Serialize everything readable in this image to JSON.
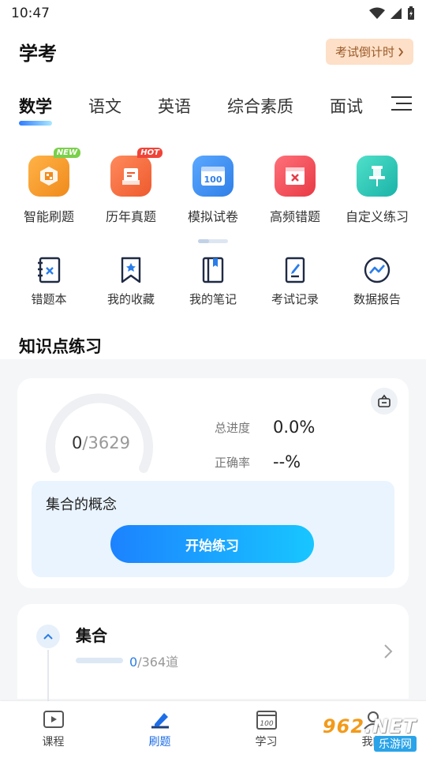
{
  "status": {
    "time": "10:47"
  },
  "header": {
    "title": "学考",
    "countdown_label": "考试倒计时"
  },
  "tabs": [
    {
      "label": "数学",
      "active": true
    },
    {
      "label": "语文"
    },
    {
      "label": "英语"
    },
    {
      "label": "综合素质"
    },
    {
      "label": "面试"
    }
  ],
  "quick_grid": [
    {
      "label": "智能刷题",
      "tag": "NEW",
      "icon": "smart-practice-icon",
      "color": "#f59a2b"
    },
    {
      "label": "历年真题",
      "tag": "HOT",
      "icon": "past-papers-icon",
      "color": "#f26b3a"
    },
    {
      "label": "模拟试卷",
      "icon": "mock-exam-icon",
      "icon_text": "100",
      "color": "#3b8cf0"
    },
    {
      "label": "高频错题",
      "icon": "frequent-errors-icon",
      "color": "#ef4a54"
    },
    {
      "label": "自定义练习",
      "icon": "custom-practice-icon",
      "color": "#2ac3b6"
    }
  ],
  "tools": [
    {
      "label": "错题本",
      "icon": "error-book-icon"
    },
    {
      "label": "我的收藏",
      "icon": "bookmark-icon"
    },
    {
      "label": "我的笔记",
      "icon": "notebook-icon"
    },
    {
      "label": "考试记录",
      "icon": "exam-record-icon"
    },
    {
      "label": "数据报告",
      "icon": "data-report-icon"
    }
  ],
  "knowledge": {
    "section_title": "知识点练习",
    "done": "0",
    "total": "3629",
    "progress_label": "总进度",
    "progress_value": "0.0%",
    "accuracy_label": "正确率",
    "accuracy_value": "--%",
    "current_topic": "集合的概念",
    "start_label": "开始练习"
  },
  "chapter": {
    "title": "集合",
    "done": "0",
    "total_text": "/364道"
  },
  "bottom_nav": [
    {
      "label": "课程",
      "icon": "course-icon"
    },
    {
      "label": "刷题",
      "icon": "practice-icon",
      "active": true
    },
    {
      "label": "学习",
      "icon": "study-icon"
    },
    {
      "label": "我的",
      "icon": "profile-icon"
    }
  ],
  "watermark": {
    "top": "962",
    "top_suffix": ".NET",
    "bottom": "乐游网"
  },
  "colors": {
    "accent": "#1e6ee8",
    "countdown_bg": "#fde0c7",
    "concept_bg": "#eaf4fe"
  }
}
